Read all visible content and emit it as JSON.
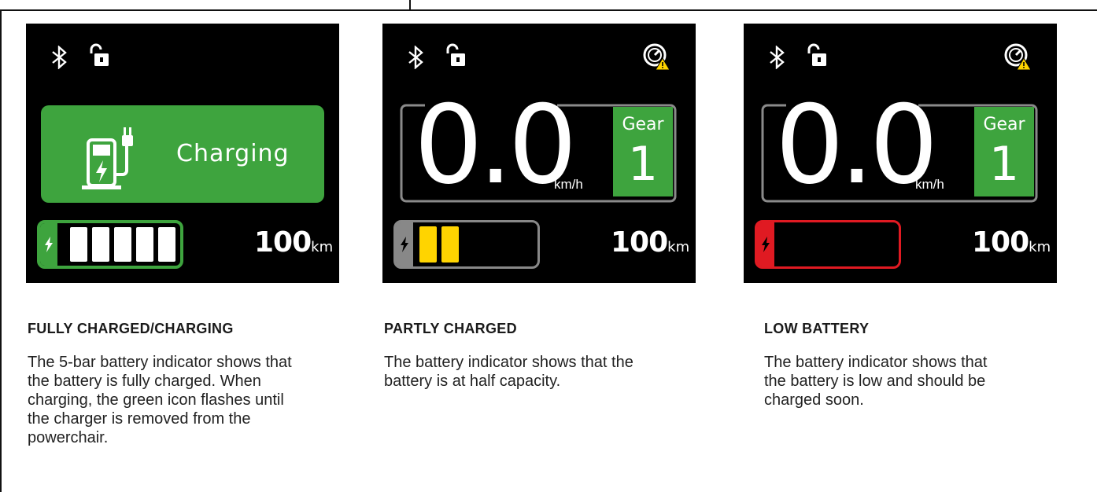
{
  "panels": [
    {
      "id": "fully-charged",
      "charging_label": "Charging",
      "range_value": "100",
      "range_unit": "km",
      "battery_bars_filled": 5,
      "battery_bars_total": 5,
      "battery_color": "#3ea43e",
      "caption_title": "FULLY CHARGED/CHARGING",
      "caption_body": "The 5-bar battery indicator shows that the battery is fully charged. When charging, the green icon flashes until the charger is removed from the powerchair."
    },
    {
      "id": "partly-charged",
      "speed_value": "0.0",
      "speed_unit": "km/h",
      "gear_label": "Gear",
      "gear_value": "1",
      "range_value": "100",
      "range_unit": "km",
      "battery_bars_filled": 2,
      "battery_bars_total": 5,
      "battery_color": "#ffd400",
      "caption_title": "PARTLY CHARGED",
      "caption_body": "The battery indicator shows that the battery is at half capacity."
    },
    {
      "id": "low-battery",
      "speed_value": "0.0",
      "speed_unit": "km/h",
      "gear_label": "Gear",
      "gear_value": "1",
      "range_value": "100",
      "range_unit": "km",
      "battery_bars_filled": 0,
      "battery_bars_total": 5,
      "battery_color": "#e01a22",
      "caption_title": "LOW BATTERY",
      "caption_body": "The battery indicator shows that the battery is low and should be charged soon."
    }
  ],
  "icons": [
    "bluetooth-icon",
    "unlock-icon",
    "speed-limit-warning-icon",
    "charging-station-icon",
    "lightning-bolt-icon"
  ],
  "colors": {
    "accent_green": "#3ea43e",
    "warning_yellow": "#ffd400",
    "alert_red": "#e01a22",
    "neutral_gray": "#888888"
  }
}
